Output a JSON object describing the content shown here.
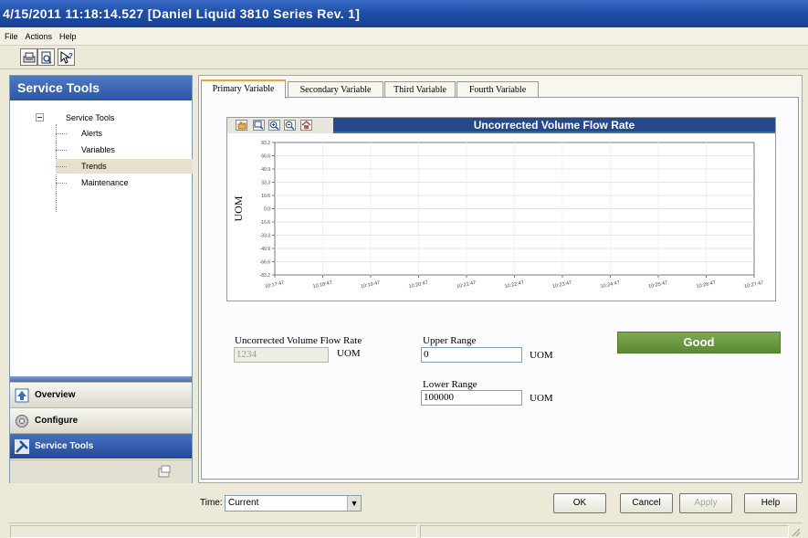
{
  "window": {
    "title": "4/15/2011 11:18:14.527 [Daniel Liquid 3810 Series Rev. 1]"
  },
  "menu": {
    "items": [
      "File",
      "Actions",
      "Help"
    ]
  },
  "toolbar": {
    "icons": [
      "print-icon",
      "print-preview-icon",
      "help-pointer-icon"
    ]
  },
  "sidebar": {
    "header": "Service Tools",
    "tree_root": "Service Tools",
    "tree_items": [
      "Alerts",
      "Variables",
      "Trends",
      "Maintenance"
    ],
    "selected": "Trends",
    "nav": {
      "overview": "Overview",
      "configure": "Configure",
      "service_tools": "Service Tools"
    }
  },
  "tabs": [
    "Primary Variable",
    "Secondary Variable",
    "Third Variable",
    "Fourth Variable"
  ],
  "active_tab": "Primary Variable",
  "chart": {
    "title": "Uncorrected Volume Flow Rate",
    "tool_icons": [
      "pan-icon",
      "zoom-box-icon",
      "zoom-in-icon",
      "zoom-out-icon",
      "home-icon"
    ]
  },
  "chart_data": {
    "type": "line",
    "title": "Uncorrected Volume Flow Rate",
    "ylabel": "UOM",
    "xlabel": "",
    "yticks": [
      "83.2",
      "66.6",
      "49.9",
      "33.3",
      "16.6",
      "0.0",
      "-16.6",
      "-33.3",
      "-49.9",
      "-66.6",
      "-83.2"
    ],
    "xticks": [
      "10:17:47",
      "10:18:47",
      "10:19:47",
      "10:20:47",
      "10:21:47",
      "10:22:47",
      "10:23:47",
      "10:24:47",
      "10:25:47",
      "10:26:47",
      "10:27:47"
    ],
    "ylim": [
      -83.2,
      83.2
    ],
    "grid": true,
    "series": []
  },
  "fields": {
    "flow_rate": {
      "label": "Uncorrected Volume Flow Rate",
      "value": "1234",
      "unit": "UOM"
    },
    "upper_range": {
      "label": "Upper Range",
      "value": "0",
      "unit": "UOM"
    },
    "lower_range": {
      "label": "Lower Range",
      "value": "100000",
      "unit": "UOM"
    }
  },
  "status": {
    "text": "Good",
    "color": "#6a9a3e"
  },
  "time": {
    "label": "Time:",
    "value": "Current"
  },
  "buttons": {
    "ok": "OK",
    "cancel": "Cancel",
    "apply": "Apply",
    "help": "Help"
  },
  "colors": {
    "title_bar": "#1f4fa8",
    "accent_tab": "#e9a53b",
    "chart_header": "#26498e"
  }
}
